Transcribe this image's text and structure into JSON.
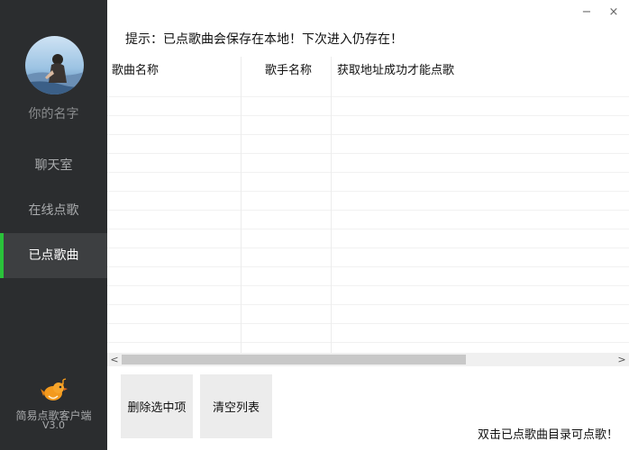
{
  "sidebar": {
    "username": "你的名字",
    "items": [
      {
        "label": "聊天室"
      },
      {
        "label": "在线点歌"
      },
      {
        "label": "已点歌曲"
      }
    ],
    "app_name": "简易点歌客户端",
    "app_version": "V3.0",
    "active_color": "#2ac23a"
  },
  "window": {
    "minimize": "−",
    "close": "×"
  },
  "tip": "提示：已点歌曲会保存在本地！下次进入仍存在！",
  "table": {
    "columns": [
      "歌曲名称",
      "歌手名称",
      "获取地址成功才能点歌"
    ]
  },
  "scrollbar": {
    "left": "<",
    "right": ">"
  },
  "buttons": {
    "delete_selected": "删除选中项",
    "clear_list": "清空列表"
  },
  "hint": "双击已点歌曲目录可点歌！"
}
